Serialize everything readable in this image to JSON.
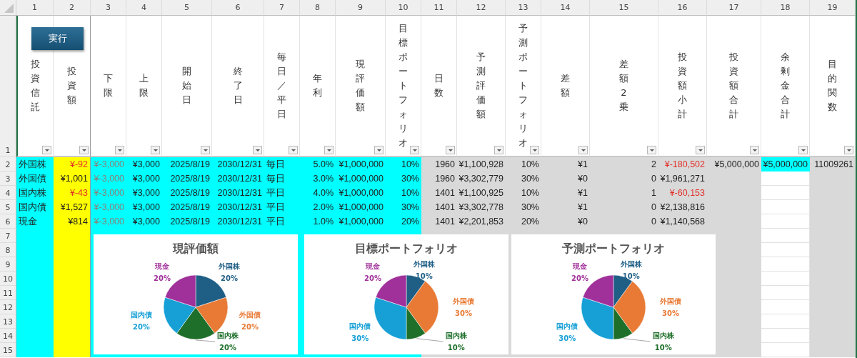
{
  "sheet": {
    "column_numbers": [
      "1",
      "2",
      "3",
      "4",
      "5",
      "6",
      "7",
      "8",
      "9",
      "10",
      "11",
      "12",
      "13",
      "14",
      "15",
      "16",
      "17",
      "18",
      "19"
    ],
    "row_numbers": [
      "1",
      "2",
      "3",
      "4",
      "5",
      "6",
      "7",
      "8",
      "9",
      "10",
      "11",
      "12",
      "13",
      "14",
      "15"
    ]
  },
  "run_button": "実行",
  "table": {
    "columns": [
      {
        "label": "投資信託",
        "kind": "text",
        "color": "#00ffff"
      },
      {
        "label": "投資額",
        "kind": "number",
        "color": "#ffff00"
      },
      {
        "label": "下限",
        "kind": "number",
        "color": "#00ffff"
      },
      {
        "label": "上限",
        "kind": "number",
        "color": "#00ffff"
      },
      {
        "label": "開始日",
        "kind": "number",
        "color": "#00ffff"
      },
      {
        "label": "終了日",
        "kind": "number",
        "color": "#00ffff"
      },
      {
        "label": "毎日／平日",
        "kind": "text",
        "color": "#00ffff"
      },
      {
        "label": "年利",
        "kind": "number",
        "color": "#00ffff"
      },
      {
        "label": "現評価額",
        "kind": "number",
        "color": "#00ffff"
      },
      {
        "label": "目標ポートフォリオ",
        "kind": "number",
        "color": "#00ffff"
      },
      {
        "label": "日数",
        "kind": "number",
        "color": "#d9d9d9"
      },
      {
        "label": "予測評価額",
        "kind": "number",
        "color": "#d9d9d9"
      },
      {
        "label": "予測ポートフォリオ",
        "kind": "number",
        "color": "#d9d9d9"
      },
      {
        "label": "差額",
        "kind": "number",
        "color": "#d9d9d9"
      },
      {
        "label": "差額2乗",
        "kind": "number",
        "color": "#d9d9d9"
      },
      {
        "label": "投資額小計",
        "kind": "number",
        "color": "#d9d9d9"
      },
      {
        "label": "投資額合計",
        "kind": "number",
        "color": "#d9d9d9"
      },
      {
        "label": "余剰金合計",
        "kind": "number",
        "color": "#ffffff"
      },
      {
        "label": "目的関数",
        "kind": "number",
        "color": "#d9d9d9"
      }
    ],
    "rows": [
      {
        "cells": [
          {
            "text": "外国株"
          },
          {
            "text": "¥-92",
            "negative": true
          },
          {
            "text": "¥-3,000",
            "muted": true
          },
          {
            "text": "¥3,000"
          },
          {
            "text": "2025/8/19"
          },
          {
            "text": "2030/12/31"
          },
          {
            "text": "毎日"
          },
          {
            "text": "5.0%"
          },
          {
            "text": "¥1,000,000"
          },
          {
            "text": "10%"
          },
          {
            "text": "1960"
          },
          {
            "text": "¥1,100,928"
          },
          {
            "text": "10%"
          },
          {
            "text": "¥1"
          },
          {
            "text": "2"
          },
          {
            "text": "¥-180,502",
            "negative": true
          },
          {
            "text": "¥5,000,000"
          },
          {
            "text": "¥5,000,000",
            "highlighted": true
          },
          {
            "text": "11009261"
          }
        ]
      },
      {
        "cells": [
          {
            "text": "外国債"
          },
          {
            "text": "¥1,001"
          },
          {
            "text": "¥-3,000",
            "muted": true
          },
          {
            "text": "¥3,000"
          },
          {
            "text": "2025/8/19"
          },
          {
            "text": "2030/12/31"
          },
          {
            "text": "毎日"
          },
          {
            "text": "3.0%"
          },
          {
            "text": "¥1,000,000"
          },
          {
            "text": "30%"
          },
          {
            "text": "1960"
          },
          {
            "text": "¥3,302,779"
          },
          {
            "text": "30%"
          },
          {
            "text": "¥0"
          },
          {
            "text": "0"
          },
          {
            "text": "¥1,961,271"
          }
        ]
      },
      {
        "cells": [
          {
            "text": "国内株"
          },
          {
            "text": "¥-43",
            "negative": true
          },
          {
            "text": "¥-3,000",
            "muted": true
          },
          {
            "text": "¥3,000"
          },
          {
            "text": "2025/8/19"
          },
          {
            "text": "2030/12/31"
          },
          {
            "text": "平日"
          },
          {
            "text": "4.0%"
          },
          {
            "text": "¥1,000,000"
          },
          {
            "text": "10%"
          },
          {
            "text": "1401"
          },
          {
            "text": "¥1,100,925"
          },
          {
            "text": "10%"
          },
          {
            "text": "¥1"
          },
          {
            "text": "1"
          },
          {
            "text": "¥-60,153",
            "negative": true
          }
        ]
      },
      {
        "cells": [
          {
            "text": "国内債"
          },
          {
            "text": "¥1,527"
          },
          {
            "text": "¥-3,000",
            "muted": true
          },
          {
            "text": "¥3,000"
          },
          {
            "text": "2025/8/19"
          },
          {
            "text": "2030/12/31"
          },
          {
            "text": "平日"
          },
          {
            "text": "2.0%"
          },
          {
            "text": "¥1,000,000"
          },
          {
            "text": "30%"
          },
          {
            "text": "1401"
          },
          {
            "text": "¥3,302,778"
          },
          {
            "text": "30%"
          },
          {
            "text": "¥1"
          },
          {
            "text": "0"
          },
          {
            "text": "¥2,138,816"
          }
        ]
      },
      {
        "cells": [
          {
            "text": "現金"
          },
          {
            "text": "¥814"
          },
          {
            "text": "¥-3,000",
            "muted": true
          },
          {
            "text": "¥3,000"
          },
          {
            "text": "2025/8/19"
          },
          {
            "text": "2030/12/31"
          },
          {
            "text": "平日"
          },
          {
            "text": "1.0%"
          },
          {
            "text": "¥1,000,000"
          },
          {
            "text": "20%"
          },
          {
            "text": "1401"
          },
          {
            "text": "¥2,201,853"
          },
          {
            "text": "20%"
          },
          {
            "text": "¥0"
          },
          {
            "text": "0"
          },
          {
            "text": "¥1,140,568"
          }
        ]
      }
    ]
  },
  "charts": [
    {
      "chart_data": {
        "type": "pie",
        "title": "現評価額",
        "categories": [
          "外国株",
          "外国債",
          "国内株",
          "国内債",
          "現金"
        ],
        "values": [
          20,
          20,
          20,
          20,
          20
        ],
        "value_labels": [
          "20%",
          "20%",
          "20%",
          "20%",
          "20%"
        ],
        "colors": [
          "#1f5f86",
          "#e87a35",
          "#1e6f2a",
          "#16a0d6",
          "#a0309a"
        ]
      }
    },
    {
      "chart_data": {
        "type": "pie",
        "title": "目標ポートフォリオ",
        "categories": [
          "外国株",
          "外国債",
          "国内株",
          "国内債",
          "現金"
        ],
        "values": [
          10,
          30,
          10,
          30,
          20
        ],
        "value_labels": [
          "10%",
          "30%",
          "10%",
          "30%",
          "20%"
        ],
        "colors": [
          "#1f5f86",
          "#e87a35",
          "#1e6f2a",
          "#16a0d6",
          "#a0309a"
        ]
      }
    },
    {
      "chart_data": {
        "type": "pie",
        "title": "予測ポートフォリオ",
        "categories": [
          "外国株",
          "外国債",
          "国内株",
          "国内債",
          "現金"
        ],
        "values": [
          10,
          30,
          10,
          30,
          20
        ],
        "value_labels": [
          "10%",
          "30%",
          "10%",
          "30%",
          "20%"
        ],
        "colors": [
          "#1f5f86",
          "#e87a35",
          "#1e6f2a",
          "#16a0d6",
          "#a0309a"
        ]
      }
    }
  ]
}
